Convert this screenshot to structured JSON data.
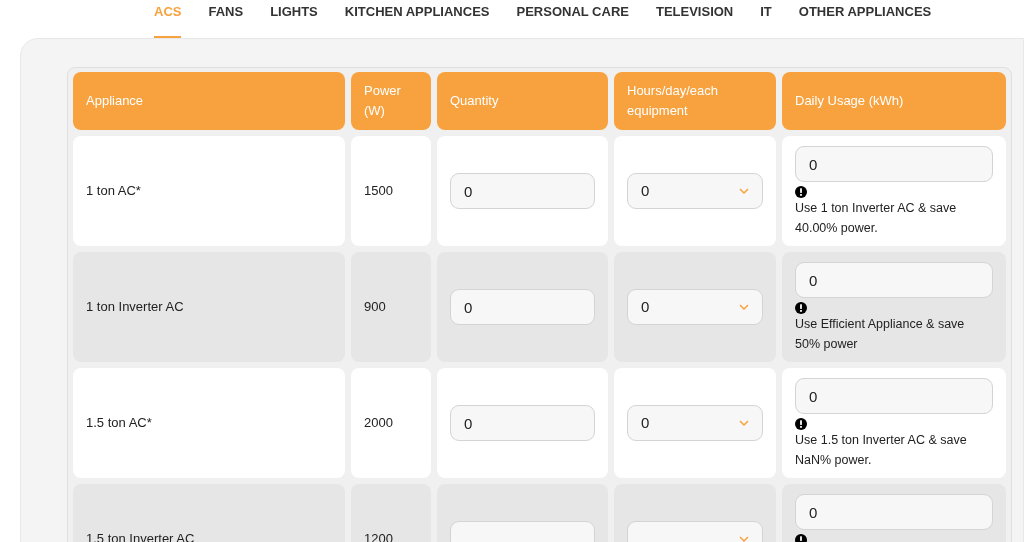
{
  "tabs": [
    {
      "label": "ACS",
      "selected": true
    },
    {
      "label": "FANS",
      "selected": false
    },
    {
      "label": "LIGHTS",
      "selected": false
    },
    {
      "label": "KITCHEN APPLIANCES",
      "selected": false
    },
    {
      "label": "PERSONAL CARE",
      "selected": false
    },
    {
      "label": "TELEVISION",
      "selected": false
    },
    {
      "label": "IT",
      "selected": false
    },
    {
      "label": "OTHER APPLIANCES",
      "selected": false
    }
  ],
  "table": {
    "columns": [
      "Appliance",
      "Power (W)",
      "Quantity",
      "Hours/day/each equipment",
      "Daily Usage (kWh)"
    ],
    "rows": [
      {
        "appliance": "1 ton AC*",
        "power": "1500",
        "quantity": "0",
        "hours": "0",
        "daily_usage": "0",
        "note": "Use 1 ton Inverter AC & save 40.00% power."
      },
      {
        "appliance": "1 ton Inverter AC",
        "power": "900",
        "quantity": "0",
        "hours": "0",
        "daily_usage": "0",
        "note": "Use Efficient Appliance & save 50% power"
      },
      {
        "appliance": "1.5 ton AC*",
        "power": "2000",
        "quantity": "0",
        "hours": "0",
        "daily_usage": "0",
        "note": "Use 1.5 ton Inverter AC & save NaN% power."
      },
      {
        "appliance": "1.5 ton Inverter AC",
        "power": "1200",
        "daily_usage": "0"
      }
    ]
  }
}
